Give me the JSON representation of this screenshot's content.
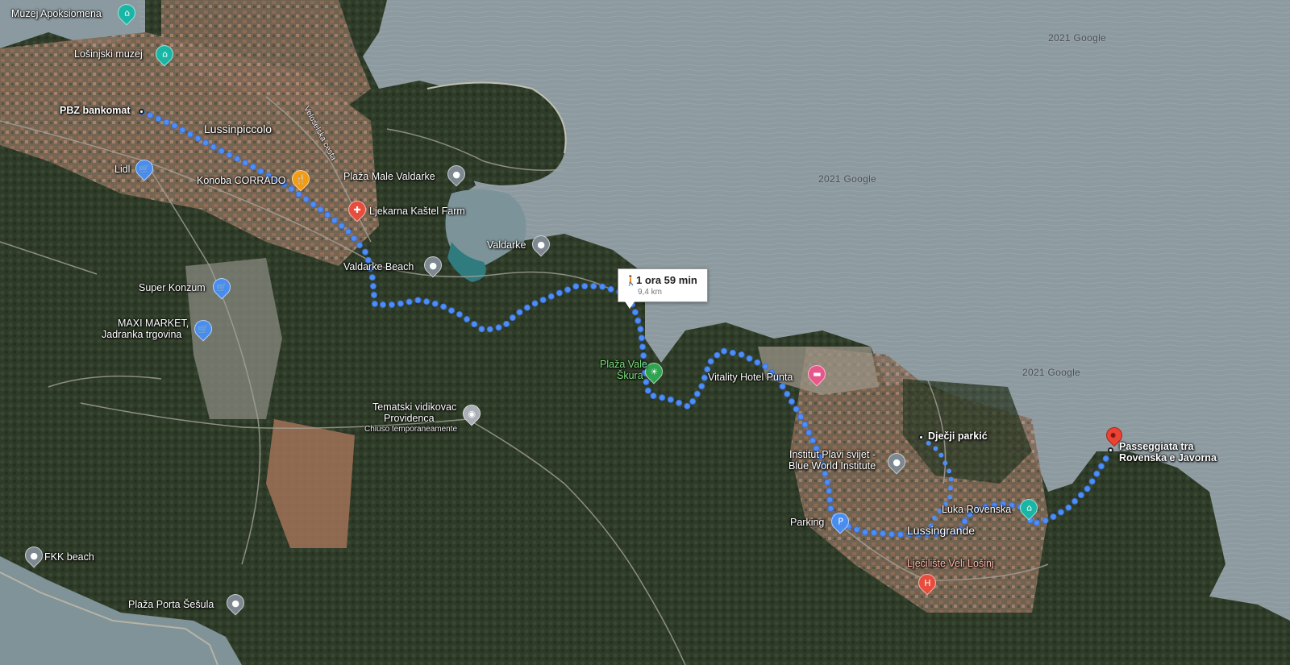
{
  "map": {
    "type": "satellite",
    "route": {
      "mode": "walking",
      "duration": "1 ora 59 min",
      "distance": "9,4 km",
      "color": "#4285f4"
    },
    "colors": {
      "sea": "#8c9aa0",
      "land": "#3f4a34",
      "forest": "#2c3a26",
      "town": "#8a6f5a"
    },
    "start": {
      "label": "PBZ bankomat"
    },
    "destination": {
      "label_line1": "Passeggiata tra",
      "label_line2": "Rovenska e Javorna"
    },
    "waypoint": {
      "label": "Dječji parkić"
    },
    "places": {
      "muzej_apoksiomena": "Muzej Apoksiomena",
      "losinjski_muzej": "Lošinjski muzej",
      "lussinpiccolo": "Lussinpiccolo",
      "veloselska": "Veloselska cesta",
      "lidl": "Lidl",
      "konoba": "Konoba CORRADO",
      "plaza_male_valdarke": "Plaža Male Valdarke",
      "ljekarna": "Ljekarna Kaštel Farm",
      "valdarke": "Valdarke",
      "valdarke_beach": "Valdarke Beach",
      "super_konzum": "Super Konzum",
      "maxi_market_1": "MAXI MARKET,",
      "maxi_market_2": "Jadranka trgovina",
      "plaza_vale_skura_1": "Plaža Vale",
      "plaza_vale_skura_2": "Škura",
      "vitality": "Vitality Hotel Punta",
      "tematski_1": "Tematski vidikovac",
      "tematski_2": "Providenca",
      "tematski_3": "Chiuso temporaneamente",
      "institut_1": "Institut Plavi svijet -",
      "institut_2": "Blue World Institute",
      "parking": "Parking",
      "lussingrande": "Lussingrande",
      "luka_rovenska": "Luka Rovenska",
      "ljeciliste": "Lječilište Veli Lošinj",
      "fkk": "FKK beach",
      "plaza_porta": "Plaža Porta Šešula"
    },
    "watermarks": [
      "2021 Google",
      "2021 Google",
      "2021 Google"
    ],
    "icons": {
      "museum": "museum-icon",
      "shopping": "cart-icon",
      "restaurant": "fork-knife-icon",
      "pharmacy": "pharmacy-icon",
      "beach": "beach-icon",
      "hotel": "bed-icon",
      "viewpoint": "camera-icon",
      "parking": "parking-icon",
      "hospital": "hospital-icon",
      "place": "place-icon"
    }
  }
}
